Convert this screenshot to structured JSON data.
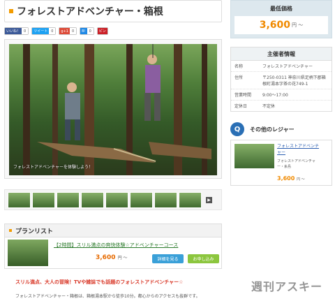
{
  "title": "フォレストアドベンチャー・箱根",
  "share": [
    {
      "label": "いいね！",
      "count": "0",
      "color": "#3b5998",
      "icon": "facebook-icon"
    },
    {
      "label": "ツイート",
      "count": "0",
      "color": "#1da1f2",
      "icon": "twitter-icon"
    },
    {
      "label": "g+1",
      "count": "0",
      "color": "#dd4b39",
      "icon": "google-plus-icon"
    },
    {
      "label": "B!",
      "count": "0",
      "color": "#1e88e5",
      "icon": "hatena-icon"
    },
    {
      "label": "ピン",
      "count": "",
      "color": "#cb2027",
      "icon": "pinterest-icon"
    }
  ],
  "gallery": {
    "caption": "フォレストアドベンチャーを体験しよう！",
    "next_arrow": "▶"
  },
  "plans": {
    "heading": "プランリスト",
    "items": [
      {
        "name": "【2時間】スリル満点の爽快体験☆アドベンチャーコース",
        "price": "3,600",
        "price_unit": "円 ～",
        "detail_button": "詳細を見る",
        "apply_button": "お申し込み"
      }
    ]
  },
  "promo": {
    "headline": "スリル満点、大人の冒険！TVや雑誌でも話題のフォレストアドベンチャー☆",
    "text": "フォレストアドベンチャー・箱根は、箱根湯本駅から徒歩10分。都心からのアクセスも抜群です。"
  },
  "price_box": {
    "label": "最低価格",
    "value": "3,600",
    "unit": "円 ～"
  },
  "organizer": {
    "heading": "主催者情報",
    "rows": [
      {
        "key": "名称",
        "value": "フォレストアドベンチャー"
      },
      {
        "key": "住所",
        "value": "〒250-0311 神奈川県足柄下郡箱根町湯本字茶の花749-1"
      },
      {
        "key": "営業時間",
        "value": "9:00～17:00"
      },
      {
        "key": "定休日",
        "value": "不定休"
      }
    ]
  },
  "other_leisure": {
    "heading": "その他のレジャー",
    "card": {
      "name_line1": "フォレストアドベンチ",
      "name_line2": "ャー",
      "sub_line1": "フォレストアドベンチャ",
      "sub_line2": "ー・糸島",
      "price": "3,600",
      "unit": "円 ～"
    }
  },
  "watermark": "週刊アスキー"
}
